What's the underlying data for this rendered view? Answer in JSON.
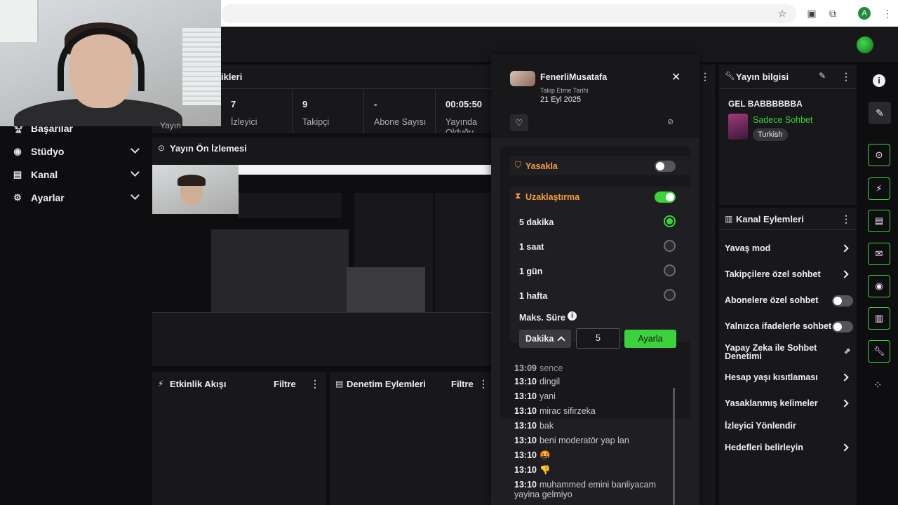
{
  "sidebar": {
    "items": [
      {
        "label": "Başarılar",
        "icon": "trophy-icon",
        "expandable": false
      },
      {
        "label": "Stüdyo",
        "icon": "studio-icon",
        "expandable": true
      },
      {
        "label": "Kanal",
        "icon": "channel-icon",
        "expandable": true
      },
      {
        "label": "Ayarlar",
        "icon": "settings-icon",
        "expandable": true
      }
    ],
    "partial_label": "Yayın"
  },
  "stats_panel": {
    "title_partial": "ikleri",
    "stats": [
      {
        "value": "7",
        "label": "İzleyici"
      },
      {
        "value": "9",
        "label": "Takipçi"
      },
      {
        "value": "-",
        "label": "Abone Sayısı"
      },
      {
        "value": "00:05:50",
        "label": "Yayında Olduğu Süre"
      }
    ]
  },
  "preview_panel": {
    "title": "Yayın Ön İzlemesi"
  },
  "activity_panel": {
    "title": "Etkinlik Akışı",
    "filter": "Filtre"
  },
  "moderation_panel": {
    "title": "Denetim Eylemleri",
    "filter": "Filtre"
  },
  "user_card": {
    "username": "FenerliMusatafa",
    "follow_label": "Takip Etme Tarihi",
    "follow_date": "21 Eyl 2025",
    "ban": {
      "label": "Yasakla",
      "on": false
    },
    "timeout": {
      "label": "Uzaklaştırma",
      "on": true,
      "options": [
        {
          "label": "5 dakika",
          "selected": true
        },
        {
          "label": "1 saat",
          "selected": false
        },
        {
          "label": "1 gün",
          "selected": false
        },
        {
          "label": "1 hafta",
          "selected": false
        }
      ],
      "max_label": "Maks. Süre",
      "unit": "Dakika",
      "amount": "5",
      "apply": "Ayarla"
    },
    "chat": [
      {
        "time": "13:09",
        "text": "sence"
      },
      {
        "time": "13:10",
        "text": "dingil"
      },
      {
        "time": "13:10",
        "text": "yani"
      },
      {
        "time": "13:10",
        "text": "mirac sifirzeka"
      },
      {
        "time": "13:10",
        "text": "bak"
      },
      {
        "time": "13:10",
        "text": "beni moderatör yap lan"
      },
      {
        "time": "13:10",
        "text": "🤬"
      },
      {
        "time": "13:10",
        "text": "👎"
      },
      {
        "time": "13:10",
        "text": "muhammed emini banliyacam"
      },
      {
        "time": "",
        "text": "yayina gelmiyo"
      }
    ]
  },
  "stream_info": {
    "title": "Yayın bilgisi",
    "stream_title": "GEL BABBBBBBA",
    "category": "Sadece Sohbet",
    "tag": "Turkish"
  },
  "channel_actions": {
    "title": "Kanal Eylemleri",
    "items": [
      {
        "label": "Yavaş mod",
        "kind": "arrow"
      },
      {
        "label": "Takipçilere özel sohbet",
        "kind": "arrow"
      },
      {
        "label": "Abonelere özel sohbet",
        "kind": "toggle"
      },
      {
        "label": "Yalnızca ifadelerle sohbet",
        "kind": "toggle"
      },
      {
        "label": "Yapay Zeka ile Sohbet Denetimi",
        "kind": "external"
      },
      {
        "label": "Hesap yaşı kısıtlaması",
        "kind": "arrow"
      },
      {
        "label": "Yasaklanmış kelimeler",
        "kind": "arrow"
      },
      {
        "label": "İzleyici Yönlendir",
        "kind": "none"
      },
      {
        "label": "Hedefleri belirleyin",
        "kind": "arrow"
      }
    ]
  },
  "colors": {
    "accent": "#3cd23c",
    "warning": "#f59d3d",
    "background": "#0e0e10",
    "panel": "#18181b"
  },
  "browser": {
    "profile_initial": "A"
  }
}
